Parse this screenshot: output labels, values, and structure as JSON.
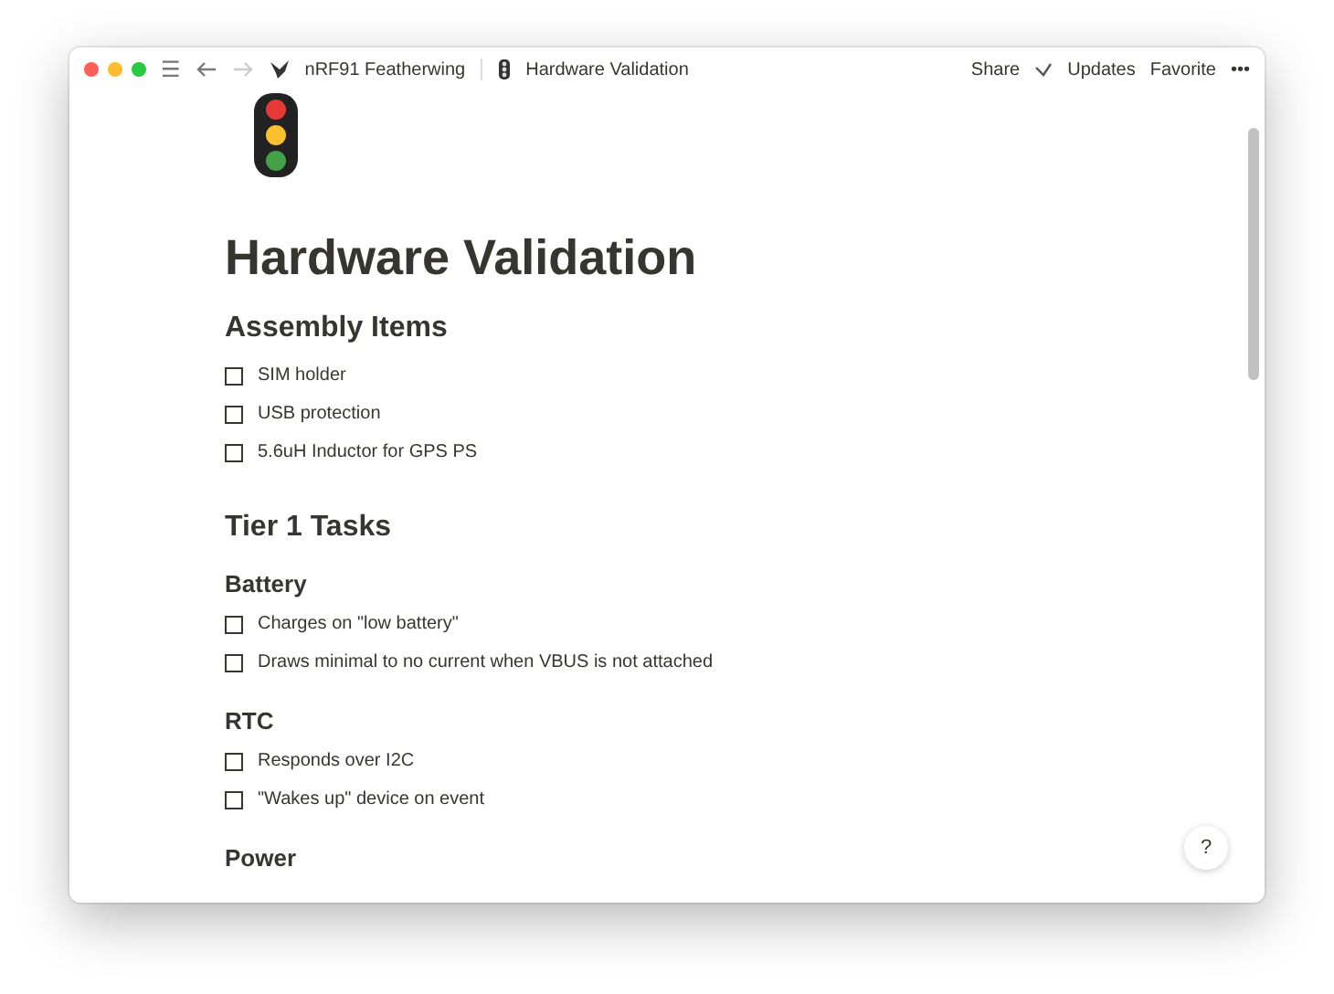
{
  "titlebar": {
    "menu_icon": "☰",
    "breadcrumbs": [
      {
        "label": "nRF91 Featherwing"
      },
      {
        "label": "Hardware Validation"
      }
    ],
    "actions": [
      {
        "label": "Share"
      },
      {
        "label": "Updates"
      },
      {
        "label": "Favorite"
      }
    ],
    "more": "•••"
  },
  "page": {
    "title": "Hardware Validation",
    "blocks": [
      {
        "kind": "h2",
        "text": "Assembly Items"
      },
      {
        "kind": "todo",
        "text": "SIM holder",
        "checked": false
      },
      {
        "kind": "todo",
        "text": "USB protection",
        "checked": false
      },
      {
        "kind": "todo",
        "text": "5.6uH Inductor for GPS PS",
        "checked": false
      },
      {
        "kind": "h2",
        "text": "Tier 1 Tasks"
      },
      {
        "kind": "h3",
        "text": "Battery"
      },
      {
        "kind": "todo",
        "text": "Charges on \"low battery\"",
        "checked": false
      },
      {
        "kind": "todo",
        "text": "Draws minimal to no current when VBUS is not attached",
        "checked": false
      },
      {
        "kind": "h3",
        "text": "RTC"
      },
      {
        "kind": "todo",
        "text": "Responds over I2C",
        "checked": false
      },
      {
        "kind": "todo",
        "text": "\"Wakes up\" device on event",
        "checked": false
      },
      {
        "kind": "h3",
        "text": "Power"
      }
    ]
  },
  "help": "?"
}
